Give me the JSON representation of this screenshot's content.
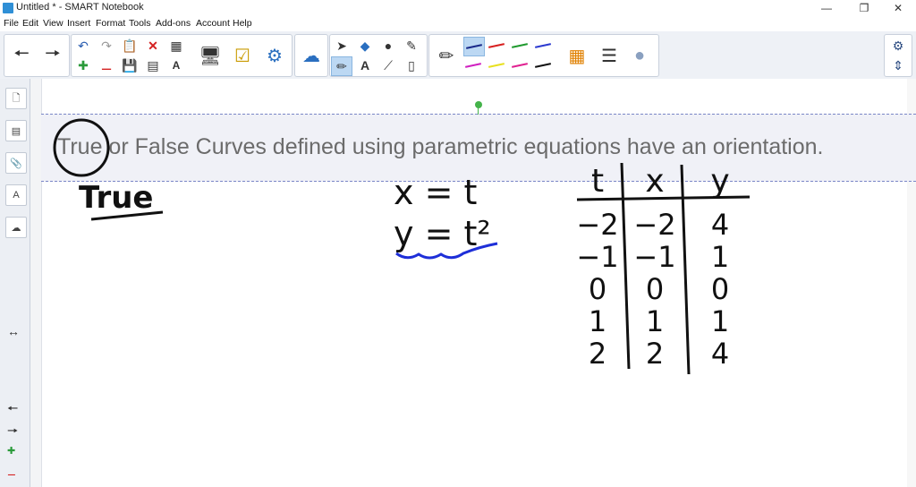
{
  "window": {
    "title": "Untitled * - SMART Notebook"
  },
  "menu": [
    "File",
    "Edit",
    "View",
    "Insert",
    "Format",
    "Tools",
    "Add-ons",
    "Account",
    "Help"
  ],
  "toolbar": {
    "nav": [
      {
        "icon": "arrow-left-icon"
      },
      {
        "icon": "arrow-right-icon"
      }
    ],
    "pens": [
      {
        "color": "#1a2a8a",
        "selected": true
      },
      {
        "color": "#d82020"
      },
      {
        "color": "#1f9a2e"
      },
      {
        "color": "#2c3ad0"
      },
      {
        "color": "#d020c0"
      },
      {
        "color": "#e8e020"
      },
      {
        "color": "#e02090"
      },
      {
        "color": "#111111"
      }
    ]
  },
  "canvas": {
    "question": "True or False Curves defined using parametric equations have an orientation.",
    "ink": {
      "answer": "True",
      "equation_x": "x = t",
      "equation_y": "y = t²",
      "table": {
        "headers": [
          "t",
          "x",
          "y"
        ],
        "rows": [
          [
            "−2",
            "−2",
            "4"
          ],
          [
            "−1",
            "−1",
            "1"
          ],
          [
            "0",
            "0",
            "0"
          ],
          [
            "1",
            "1",
            "1"
          ],
          [
            "2",
            "2",
            "4"
          ]
        ]
      }
    }
  }
}
